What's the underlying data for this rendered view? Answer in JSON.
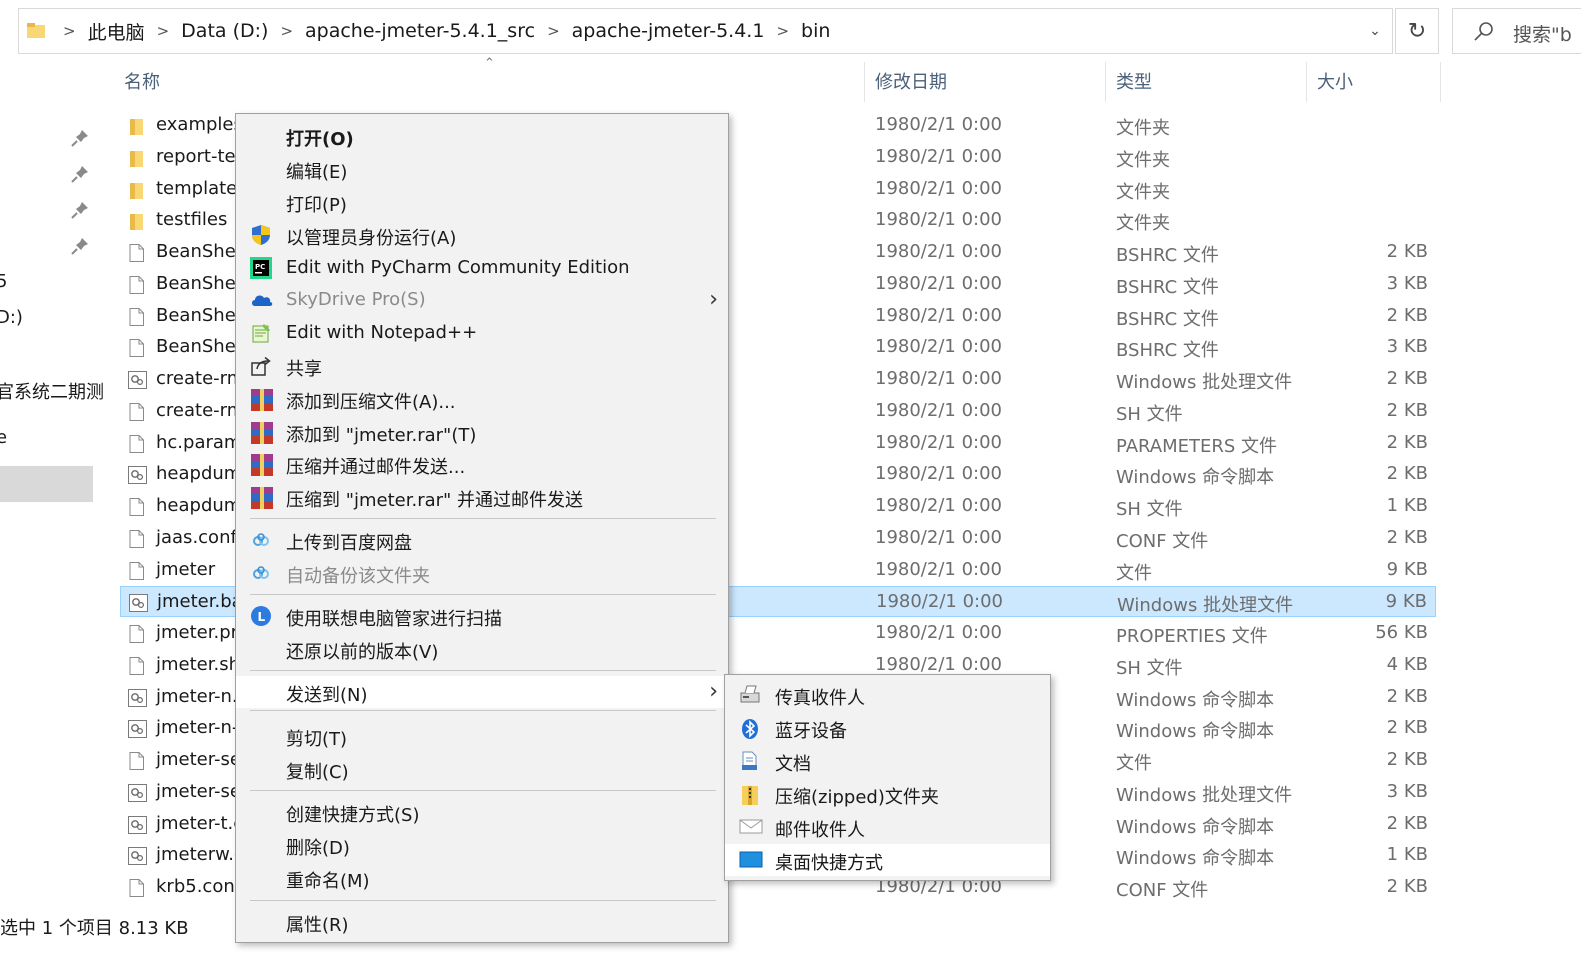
{
  "address_bar": {
    "crumbs": [
      "此电脑",
      "Data (D:)",
      "apache-jmeter-5.4.1_src",
      "apache-jmeter-5.4.1",
      "bin"
    ],
    "refresh_icon": "refresh-icon",
    "search_placeholder": "搜索\"b"
  },
  "nav": {
    "items": [
      "5",
      "D:)",
      "官系统二期测",
      "e"
    ]
  },
  "columns": {
    "name": "名称",
    "date": "修改日期",
    "type": "类型",
    "size": "大小"
  },
  "files": [
    {
      "name": "examples",
      "date": "1980/2/1 0:00",
      "type": "文件夹",
      "size": "",
      "icon": "folder-icon"
    },
    {
      "name": "report-te",
      "date": "1980/2/1 0:00",
      "type": "文件夹",
      "size": "",
      "icon": "folder-icon"
    },
    {
      "name": "templates",
      "date": "1980/2/1 0:00",
      "type": "文件夹",
      "size": "",
      "icon": "folder-icon"
    },
    {
      "name": "testfiles",
      "date": "1980/2/1 0:00",
      "type": "文件夹",
      "size": "",
      "icon": "folder-icon"
    },
    {
      "name": "BeanShel",
      "date": "1980/2/1 0:00",
      "type": "BSHRC 文件",
      "size": "2 KB",
      "icon": "file-icon"
    },
    {
      "name": "BeanShel",
      "date": "1980/2/1 0:00",
      "type": "BSHRC 文件",
      "size": "3 KB",
      "icon": "file-icon"
    },
    {
      "name": "BeanShel",
      "date": "1980/2/1 0:00",
      "type": "BSHRC 文件",
      "size": "2 KB",
      "icon": "file-icon"
    },
    {
      "name": "BeanShel",
      "date": "1980/2/1 0:00",
      "type": "BSHRC 文件",
      "size": "3 KB",
      "icon": "file-icon"
    },
    {
      "name": "create-rm",
      "date": "1980/2/1 0:00",
      "type": "Windows 批处理文件",
      "size": "2 KB",
      "icon": "script-icon"
    },
    {
      "name": "create-rm",
      "date": "1980/2/1 0:00",
      "type": "SH 文件",
      "size": "2 KB",
      "icon": "file-icon"
    },
    {
      "name": "hc.param",
      "date": "1980/2/1 0:00",
      "type": "PARAMETERS 文件",
      "size": "2 KB",
      "icon": "file-icon"
    },
    {
      "name": "heapdum",
      "date": "1980/2/1 0:00",
      "type": "Windows 命令脚本",
      "size": "2 KB",
      "icon": "script-icon"
    },
    {
      "name": "heapdum",
      "date": "1980/2/1 0:00",
      "type": "SH 文件",
      "size": "1 KB",
      "icon": "file-icon"
    },
    {
      "name": "jaas.conf",
      "date": "1980/2/1 0:00",
      "type": "CONF 文件",
      "size": "2 KB",
      "icon": "file-icon"
    },
    {
      "name": "jmeter",
      "date": "1980/2/1 0:00",
      "type": "文件",
      "size": "9 KB",
      "icon": "file-icon"
    },
    {
      "name": "jmeter.ba",
      "date": "1980/2/1 0:00",
      "type": "Windows 批处理文件",
      "size": "9 KB",
      "icon": "script-icon",
      "selected": true
    },
    {
      "name": "jmeter.pr",
      "date": "1980/2/1 0:00",
      "type": "PROPERTIES 文件",
      "size": "56 KB",
      "icon": "file-icon"
    },
    {
      "name": "jmeter.sh",
      "date": "1980/2/1 0:00",
      "type": "SH 文件",
      "size": "4 KB",
      "icon": "file-icon"
    },
    {
      "name": "jmeter-n.",
      "date": "",
      "type": "Windows 命令脚本",
      "size": "2 KB",
      "icon": "script-icon"
    },
    {
      "name": "jmeter-n-",
      "date": "",
      "type": "Windows 命令脚本",
      "size": "2 KB",
      "icon": "script-icon"
    },
    {
      "name": "jmeter-se",
      "date": "",
      "type": "文件",
      "size": "2 KB",
      "icon": "file-icon"
    },
    {
      "name": "jmeter-se",
      "date": "",
      "type": "Windows 批处理文件",
      "size": "3 KB",
      "icon": "script-icon"
    },
    {
      "name": "jmeter-t.c",
      "date": "",
      "type": "Windows 命令脚本",
      "size": "2 KB",
      "icon": "script-icon"
    },
    {
      "name": "jmeterw.c",
      "date": "",
      "type": "Windows 命令脚本",
      "size": "1 KB",
      "icon": "script-icon"
    },
    {
      "name": "krb5.conf",
      "date": "1980/2/1 0:00",
      "type": "CONF 文件",
      "size": "2 KB",
      "icon": "file-icon"
    }
  ],
  "status": "选中 1 个项目  8.13 KB",
  "context_menu": {
    "items": [
      {
        "label": "打开(O)",
        "icon": "",
        "bold": true
      },
      {
        "label": "编辑(E)",
        "icon": ""
      },
      {
        "label": "打印(P)",
        "icon": ""
      },
      {
        "label": "以管理员身份运行(A)",
        "icon": "uac-shield-icon"
      },
      {
        "label": "Edit with PyCharm Community Edition",
        "icon": "pycharm-icon"
      },
      {
        "label": "SkyDrive Pro(S)",
        "icon": "skydrive-cloud-icon",
        "disabled": true,
        "submenu": true
      },
      {
        "label": "Edit with Notepad++",
        "icon": "notepadpp-icon"
      },
      {
        "label": "共享",
        "icon": "share-icon"
      },
      {
        "label": "添加到压缩文件(A)...",
        "icon": "winrar-icon"
      },
      {
        "label": "添加到 \"jmeter.rar\"(T)",
        "icon": "winrar-icon"
      },
      {
        "label": "压缩并通过邮件发送...",
        "icon": "winrar-icon"
      },
      {
        "label": "压缩到 \"jmeter.rar\" 并通过邮件发送",
        "icon": "winrar-icon"
      },
      {
        "label": "上传到百度网盘",
        "icon": "baidu-netdisk-icon"
      },
      {
        "label": "自动备份该文件夹",
        "icon": "baidu-netdisk-icon",
        "disabled": true
      },
      {
        "label": "使用联想电脑管家进行扫描",
        "icon": "lenovo-icon"
      },
      {
        "label": "还原以前的版本(V)",
        "icon": ""
      },
      {
        "label": "发送到(N)",
        "icon": "",
        "submenu": true,
        "highlighted": true
      },
      {
        "label": "剪切(T)",
        "icon": ""
      },
      {
        "label": "复制(C)",
        "icon": ""
      },
      {
        "label": "创建快捷方式(S)",
        "icon": ""
      },
      {
        "label": "删除(D)",
        "icon": ""
      },
      {
        "label": "重命名(M)",
        "icon": ""
      },
      {
        "label": "属性(R)",
        "icon": ""
      }
    ]
  },
  "send_to_menu": {
    "items": [
      {
        "label": "传真收件人",
        "icon": "fax-icon"
      },
      {
        "label": "蓝牙设备",
        "icon": "bluetooth-icon"
      },
      {
        "label": "文档",
        "icon": "documents-icon"
      },
      {
        "label": "压缩(zipped)文件夹",
        "icon": "zip-folder-icon"
      },
      {
        "label": "邮件收件人",
        "icon": "mail-icon"
      },
      {
        "label": "桌面快捷方式",
        "icon": "desktop-icon",
        "highlighted": true
      }
    ]
  },
  "colors": {
    "selection_bg": "#cce8ff",
    "selection_border": "#99d1ff",
    "menu_bg": "#f2f2f2",
    "header_text": "#4c607a"
  }
}
